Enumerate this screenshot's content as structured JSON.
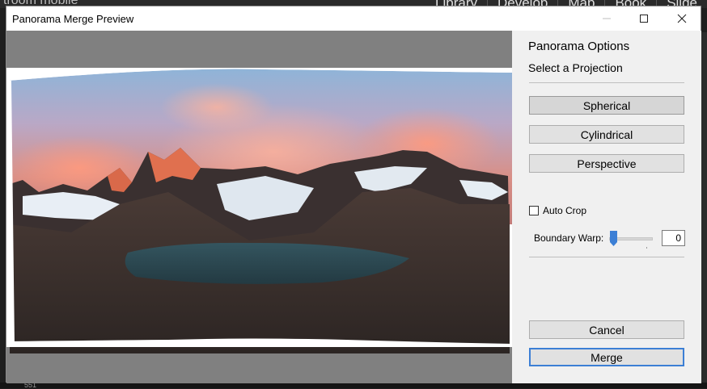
{
  "background": {
    "mobile_text": "troom mobile",
    "modules": [
      "Library",
      "Develop",
      "Map",
      "Book",
      "Slide"
    ],
    "film_number": "551"
  },
  "dialog": {
    "title": "Panorama Merge Preview",
    "window_buttons": [
      "minimize-icon",
      "maximize-icon",
      "close-icon"
    ]
  },
  "panel": {
    "options_title": "Panorama Options",
    "projection_title": "Select a Projection",
    "projections": [
      {
        "label": "Spherical",
        "selected": true
      },
      {
        "label": "Cylindrical",
        "selected": false
      },
      {
        "label": "Perspective",
        "selected": false
      }
    ],
    "auto_crop_label": "Auto Crop",
    "auto_crop_checked": false,
    "boundary_warp_label": "Boundary Warp:",
    "boundary_warp_value": "0",
    "cancel_label": "Cancel",
    "merge_label": "Merge"
  },
  "colors": {
    "accent": "#3c7fd5",
    "preview_bg": "#808080"
  }
}
